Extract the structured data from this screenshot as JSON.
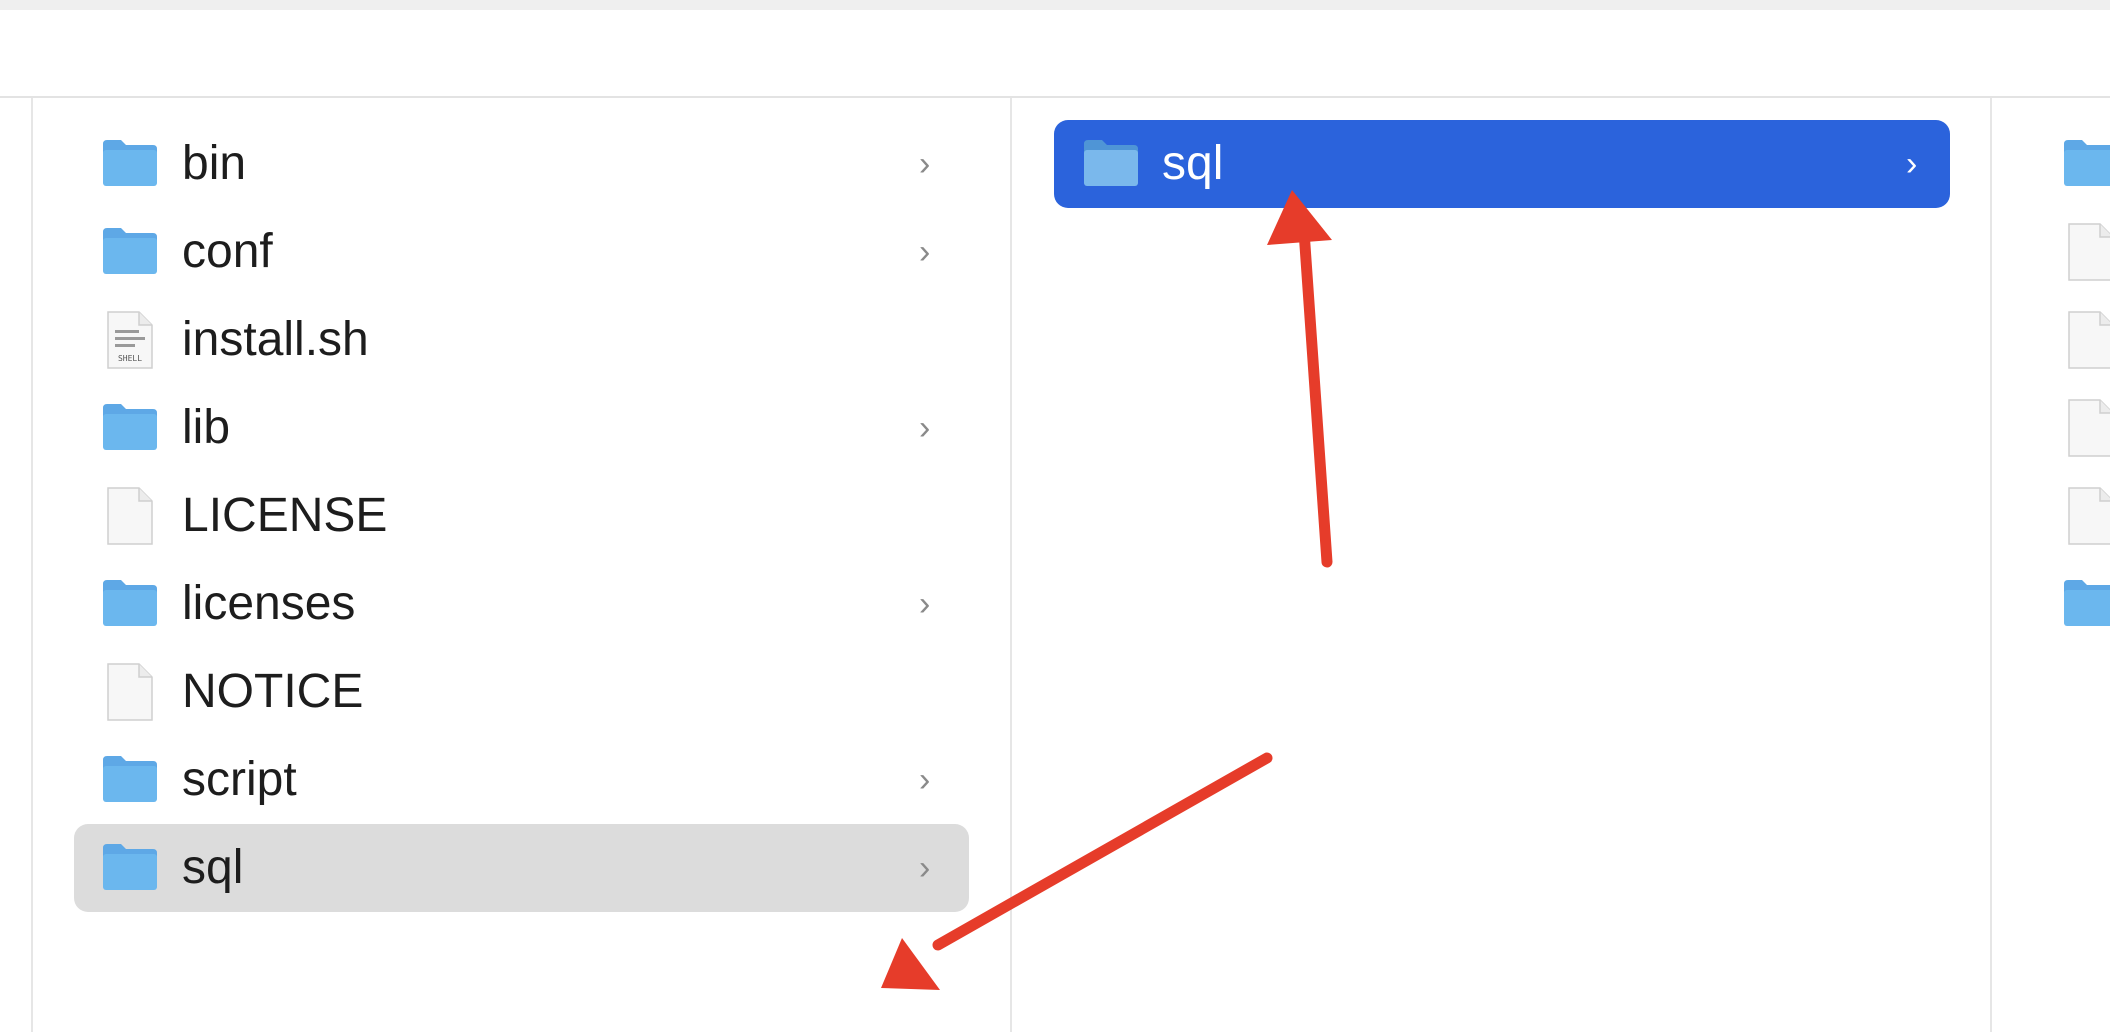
{
  "column1": {
    "items": [
      {
        "name": "bin",
        "type": "folder",
        "has_children": true
      },
      {
        "name": "conf",
        "type": "folder",
        "has_children": true
      },
      {
        "name": "install.sh",
        "type": "shell",
        "has_children": false
      },
      {
        "name": "lib",
        "type": "folder",
        "has_children": true
      },
      {
        "name": "LICENSE",
        "type": "file",
        "has_children": false
      },
      {
        "name": "licenses",
        "type": "folder",
        "has_children": true
      },
      {
        "name": "NOTICE",
        "type": "file",
        "has_children": false
      },
      {
        "name": "script",
        "type": "folder",
        "has_children": true
      },
      {
        "name": "sql",
        "type": "folder",
        "has_children": true,
        "selected": true
      }
    ]
  },
  "column2": {
    "items": [
      {
        "name": "sql",
        "type": "folder",
        "has_children": true,
        "selected": true
      }
    ]
  },
  "column3": {
    "items": [
      {
        "type": "folder"
      },
      {
        "type": "file"
      },
      {
        "type": "file"
      },
      {
        "type": "file"
      },
      {
        "type": "file"
      },
      {
        "type": "folder"
      }
    ]
  },
  "icons": {
    "chevron": "›",
    "folder": "folder-icon",
    "file": "file-icon",
    "shell_file": "shell-script-icon"
  },
  "shell_icon_text": "SHELL",
  "colors": {
    "selection_blue": "#2b63dc",
    "selection_grey": "#dcdcdc",
    "annotation_red": "#e63c2a",
    "folder_blue": "#6bb7ee"
  }
}
